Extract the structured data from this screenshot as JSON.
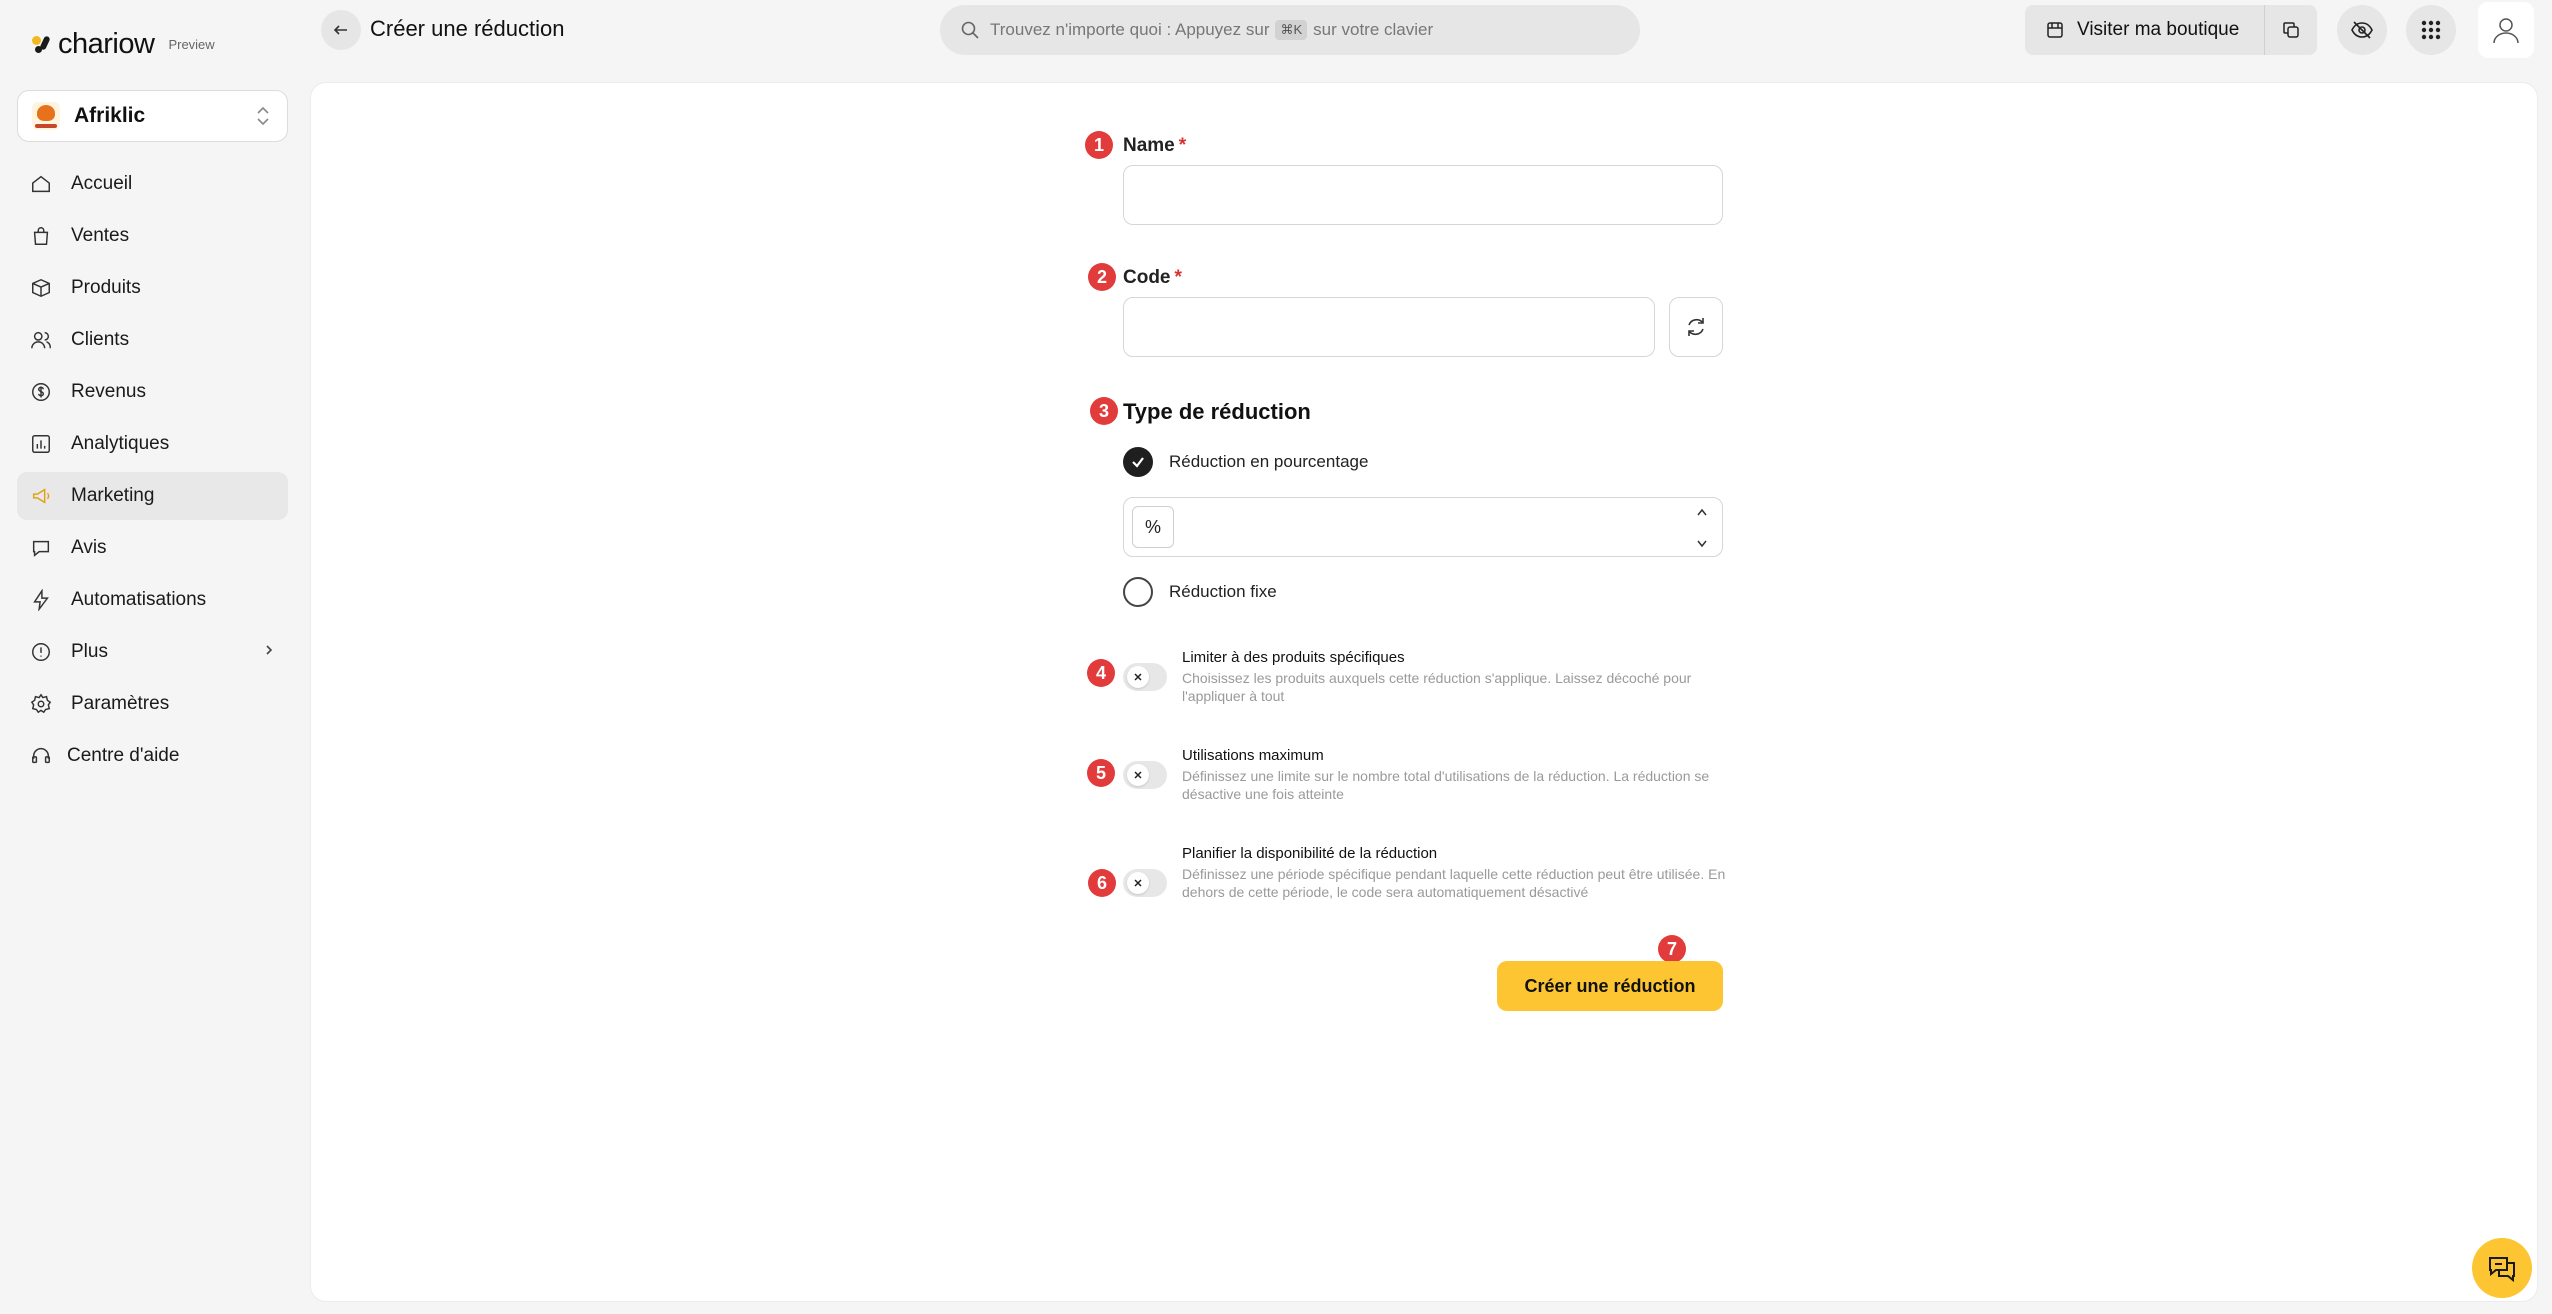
{
  "brand": {
    "name": "chariow",
    "badge": "Preview",
    "accent": "#fcc531"
  },
  "store": {
    "name": "Afriklic"
  },
  "sidebar": {
    "items": [
      {
        "label": "Accueil",
        "icon": "home-icon"
      },
      {
        "label": "Ventes",
        "icon": "shopping-bag-icon"
      },
      {
        "label": "Produits",
        "icon": "box-icon"
      },
      {
        "label": "Clients",
        "icon": "users-icon"
      },
      {
        "label": "Revenus",
        "icon": "revenue-icon"
      },
      {
        "label": "Analytiques",
        "icon": "bar-chart-icon"
      },
      {
        "label": "Marketing",
        "icon": "megaphone-icon",
        "active": true
      },
      {
        "label": "Avis",
        "icon": "chat-bubble-icon"
      },
      {
        "label": "Automatisations",
        "icon": "lightning-icon"
      },
      {
        "label": "Plus",
        "icon": "info-icon",
        "has_submenu": true
      },
      {
        "label": "Paramètres",
        "icon": "gear-icon"
      },
      {
        "label": "Centre d'aide",
        "icon": "headset-icon"
      }
    ]
  },
  "header": {
    "title": "Créer une réduction",
    "search": {
      "text_before": "Trouvez n'importe quoi : Appuyez sur",
      "shortcut": "⌘K",
      "text_after": "sur votre clavier"
    },
    "visit_label": "Visiter ma boutique"
  },
  "form": {
    "name": {
      "step": "1",
      "label": "Name",
      "required": "*",
      "value": ""
    },
    "code": {
      "step": "2",
      "label": "Code",
      "required": "*",
      "value": ""
    },
    "discount_type": {
      "step": "3",
      "title": "Type de réduction",
      "options": [
        {
          "label": "Réduction en pourcentage",
          "selected": true
        },
        {
          "label": "Réduction fixe",
          "selected": false
        }
      ],
      "percent_symbol": "%",
      "percent_value": ""
    },
    "toggles": [
      {
        "step": "4",
        "title": "Limiter à des produits spécifiques",
        "desc": "Choisissez les produits auxquels cette réduction s'applique. Laissez décoché pour l'appliquer à tout",
        "enabled": false
      },
      {
        "step": "5",
        "title": "Utilisations maximum",
        "desc": "Définissez une limite sur le nombre total d'utilisations de la réduction. La réduction se désactive une fois atteinte",
        "enabled": false
      },
      {
        "step": "6",
        "title": "Planifier la disponibilité de la réduction",
        "desc": "Définissez une période spécifique pendant laquelle cette réduction peut être utilisée. En dehors de cette période, le code sera automatiquement désactivé",
        "enabled": false
      }
    ],
    "submit": {
      "step": "7",
      "label": "Créer une réduction"
    }
  }
}
